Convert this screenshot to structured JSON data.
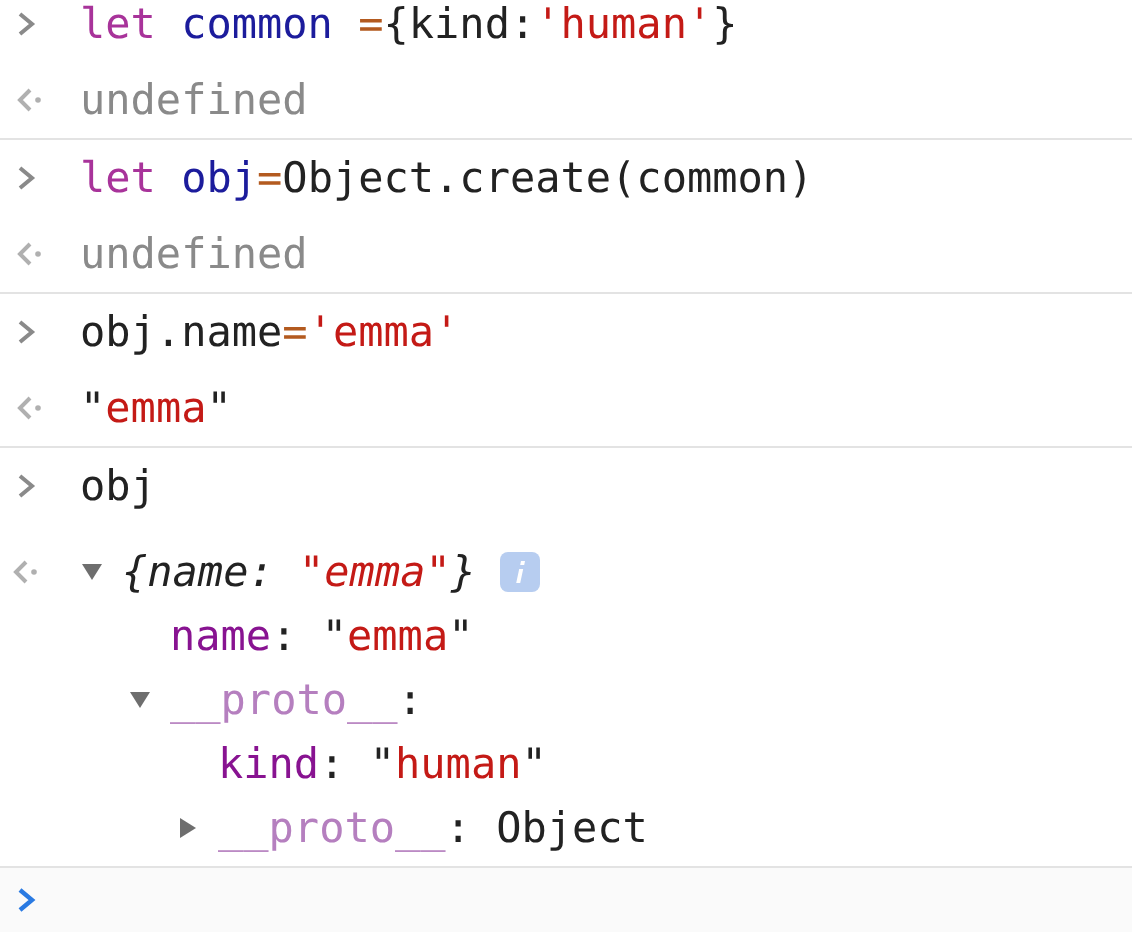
{
  "entries": [
    {
      "kind": "input",
      "tokens": [
        {
          "kind": "keyword",
          "text": "let "
        },
        {
          "kind": "variable",
          "text": "common "
        },
        {
          "kind": "operator",
          "text": "="
        },
        {
          "kind": "plain",
          "text": "{kind:"
        },
        {
          "kind": "string",
          "text": "'human'"
        },
        {
          "kind": "plain",
          "text": "}"
        }
      ]
    },
    {
      "kind": "output",
      "tokens": [
        {
          "kind": "muted",
          "text": "undefined"
        }
      ]
    },
    {
      "kind": "input",
      "tokens": [
        {
          "kind": "keyword",
          "text": "let "
        },
        {
          "kind": "variable",
          "text": "obj"
        },
        {
          "kind": "operator",
          "text": "="
        },
        {
          "kind": "plain",
          "text": "Object.create(common)"
        }
      ]
    },
    {
      "kind": "output",
      "tokens": [
        {
          "kind": "muted",
          "text": "undefined"
        }
      ]
    },
    {
      "kind": "input",
      "tokens": [
        {
          "kind": "plain",
          "text": "obj.name"
        },
        {
          "kind": "operator",
          "text": "="
        },
        {
          "kind": "string",
          "text": "'emma'"
        }
      ]
    },
    {
      "kind": "output",
      "tokens": [
        {
          "kind": "plain",
          "text": "\""
        },
        {
          "kind": "string",
          "text": "emma"
        },
        {
          "kind": "plain",
          "text": "\""
        }
      ]
    },
    {
      "kind": "input",
      "tokens": [
        {
          "kind": "plain",
          "text": "obj"
        }
      ]
    },
    {
      "kind": "output",
      "expanded": true,
      "info": true,
      "tokens": [
        {
          "kind": "italic",
          "text": "{name: "
        },
        {
          "kind": "italic_string",
          "text": "\"emma\""
        },
        {
          "kind": "italic",
          "text": "}"
        }
      ],
      "children": [
        {
          "tokens": [
            {
              "kind": "property",
              "text": "name"
            },
            {
              "kind": "plain",
              "text": ": \""
            },
            {
              "kind": "string",
              "text": "emma"
            },
            {
              "kind": "plain",
              "text": "\""
            }
          ]
        },
        {
          "expanded": true,
          "tokens": [
            {
              "kind": "proto",
              "text": "__proto__"
            },
            {
              "kind": "plain",
              "text": ":"
            }
          ],
          "children": [
            {
              "tokens": [
                {
                  "kind": "property",
                  "text": "kind"
                },
                {
                  "kind": "plain",
                  "text": ": \""
                },
                {
                  "kind": "string",
                  "text": "human"
                },
                {
                  "kind": "plain",
                  "text": "\""
                }
              ]
            },
            {
              "expanded": false,
              "tokens": [
                {
                  "kind": "proto",
                  "text": "__proto__"
                },
                {
                  "kind": "plain",
                  "text": ": Object"
                }
              ]
            }
          ]
        }
      ]
    }
  ]
}
